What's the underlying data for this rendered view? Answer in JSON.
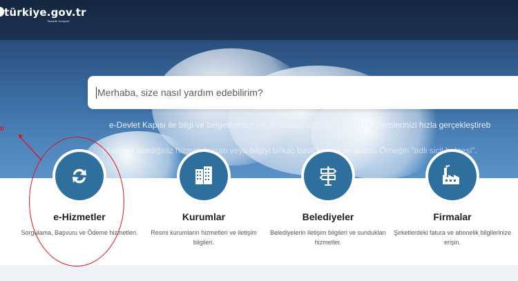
{
  "header": {
    "logo_text": "türkiye.gov.tr",
    "logo_tagline": "\"Bulabilir Kısayolu\""
  },
  "search": {
    "placeholder": "Merhaba, size nasıl yardım edebilirim?"
  },
  "hero": {
    "tagline": "e-Devlet Kapısı ile bilgi ve belgelerinize tek noktadan ulaşabilir, başvuru işlemlerinizi hızla gerçekleştireb",
    "hint": "Ulaşmak istediğiniz hizmet, kurum veya bilgiyi birkaç basit kelime ile aratın. Örneğin \"adli sicil belgesi\". "
  },
  "cards": [
    {
      "title": "e-Hizmetler",
      "desc": "Sorgulama, Başvuru ve Ödeme hizmetleri.",
      "icon": "refresh-icon"
    },
    {
      "title": "Kurumlar",
      "desc": "Resmi kurumların hizmetleri ve iletişim bilgileri.",
      "icon": "building-icon"
    },
    {
      "title": "Belediyeler",
      "desc": "Belediyelerin iletişim bilgileri ve sundukları hizmetler.",
      "icon": "signpost-icon"
    },
    {
      "title": "Firmalar",
      "desc": "Şirketlerdeki fatura ve abonelik bilgilerinize erişin.",
      "icon": "factory-icon"
    }
  ],
  "annotation": {
    "mark": "ı⁠ı",
    "color": "#e0131a"
  },
  "colors": {
    "accent": "#2f6f9e",
    "header": "#14263f"
  }
}
